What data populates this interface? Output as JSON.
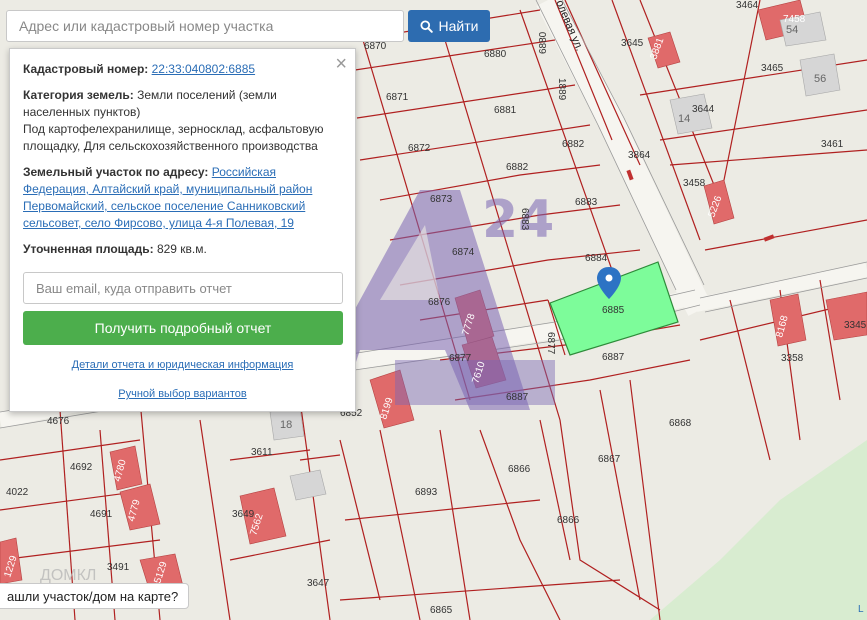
{
  "search": {
    "placeholder": "Адрес или кадастровый номер участка",
    "button_label": "Найти"
  },
  "popup": {
    "cadastral_label": "Кадастровый номер:",
    "cadastral_value": "22:33:040802:6885",
    "category_label": "Категория земель:",
    "category_value": "Земли поселений (земли населенных пунктов)",
    "usage_text": "Под картофелехранилище, зерносклад, асфальтовую площадку, Для сельскохозяйственного производства",
    "address_label": "Земельный участок по адресу:",
    "address_value": "Российская Федерация, Алтайский край, муниципальный район Первомайский, сельское поселение Санниковский сельсовет, село Фирсово, улица 4-я Полевая, 19",
    "area_label": "Уточненная площадь:",
    "area_value": "829 кв.м.",
    "email_placeholder": "Ваш email, куда отправить отчет",
    "report_button": "Получить подробный отчет",
    "details_link": "Детали отчета и юридическая информация",
    "manual_link": "Ручной выбор вариантов"
  },
  "bottom_prompt": "ашли участок/дом на карте?",
  "map": {
    "street_label": "олевая ул.",
    "watermark": "24",
    "watermark_faint": "ДОМКЛ",
    "corner_mark": "L",
    "parcels": [
      "6870",
      "6880",
      "6871",
      "6881",
      "6872",
      "6882",
      "6882",
      "6873",
      "6883",
      "6883",
      "6874",
      "6884",
      "6876",
      "6885",
      "6877",
      "6887",
      "6877",
      "6887",
      "6852",
      "6866",
      "6867",
      "6868",
      "6893",
      "6866",
      "6865",
      "3464",
      "3645",
      "3465",
      "3644",
      "3864",
      "3461",
      "3458",
      "3358",
      "3345",
      "4676",
      "4692",
      "4691",
      "4022",
      "3611",
      "3649",
      "3491",
      "3647"
    ],
    "buildings": [
      "7458",
      "3881",
      "5226",
      "8168",
      "7778",
      "7610",
      "8199",
      "4780",
      "4779",
      "7562",
      "5129",
      "1229"
    ],
    "house_numbers": [
      "54",
      "56",
      "14",
      "18",
      "1889"
    ]
  },
  "colors": {
    "selected_parcel": "#7dfc9a",
    "parcel_border": "#b02020",
    "building": "#e06a6a",
    "button_primary": "#2d6cb0",
    "button_success": "#4cae4c",
    "link": "#2a6db6",
    "marker": "#2d73c4"
  },
  "icons": [
    "search-icon",
    "close-icon",
    "map-marker-icon"
  ]
}
